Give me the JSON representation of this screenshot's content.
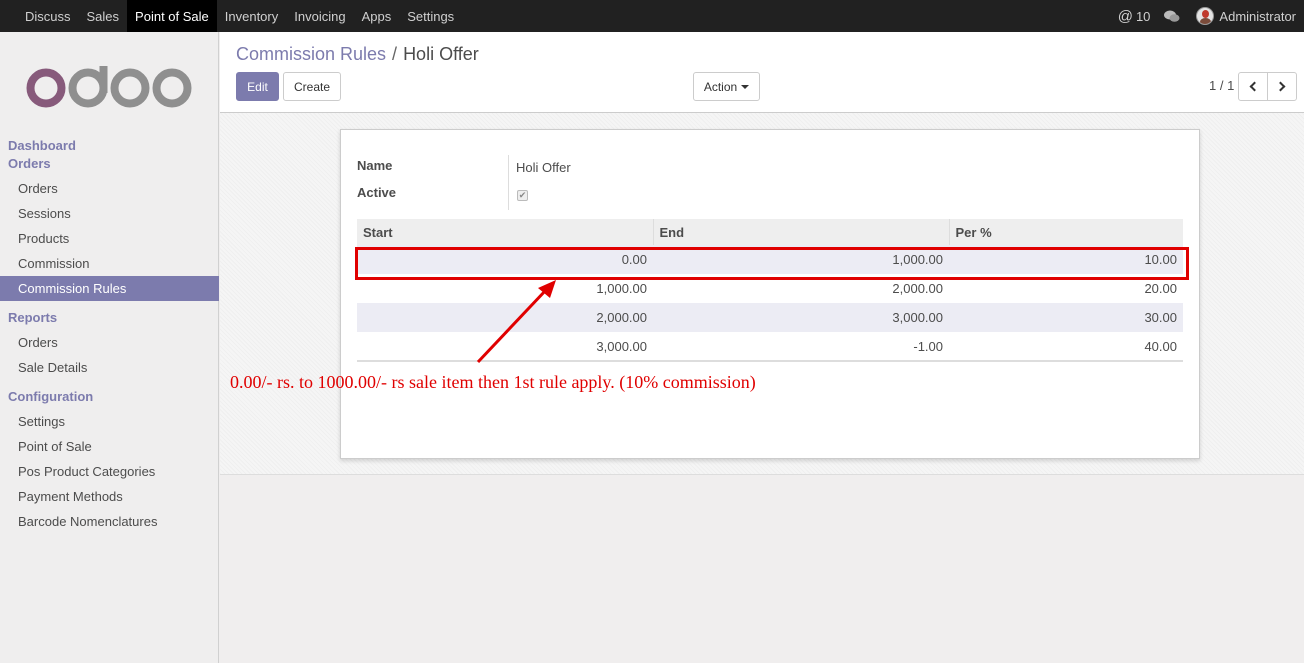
{
  "topbar": {
    "menu": [
      "Discuss",
      "Sales",
      "Point of Sale",
      "Inventory",
      "Invoicing",
      "Apps",
      "Settings"
    ],
    "active_menu": "Point of Sale",
    "mentions_count": "10",
    "mention_icon": "at-icon",
    "chat_icon": "chat-bubbles-icon",
    "user_name": "Administrator"
  },
  "brand": {
    "logo_text": "odoo",
    "logo_colors": [
      "#875a7b",
      "#8f8f8f"
    ]
  },
  "sidebar": {
    "sections": [
      {
        "title": "Dashboard",
        "items": []
      },
      {
        "title": "Orders",
        "items": [
          "Orders",
          "Sessions",
          "Products",
          "Commission",
          "Commission Rules"
        ]
      },
      {
        "title": "Reports",
        "items": [
          "Orders",
          "Sale Details"
        ]
      },
      {
        "title": "Configuration",
        "items": [
          "Settings",
          "Point of Sale",
          "Pos Product Categories",
          "Payment Methods",
          "Barcode Nomenclatures"
        ]
      }
    ],
    "active_item": "Commission Rules"
  },
  "control": {
    "breadcrumb_parent": "Commission Rules",
    "breadcrumb_sep": "/",
    "breadcrumb_current": "Holi Offer",
    "edit_label": "Edit",
    "create_label": "Create",
    "action_label": "Action",
    "pager": "1 / 1"
  },
  "form": {
    "name_label": "Name",
    "name_value": "Holi Offer",
    "active_label": "Active",
    "active_checked": true
  },
  "rules_table": {
    "columns": [
      "Start",
      "End",
      "Per %"
    ],
    "rows": [
      [
        "0.00",
        "1,000.00",
        "10.00"
      ],
      [
        "1,000.00",
        "2,000.00",
        "20.00"
      ],
      [
        "2,000.00",
        "3,000.00",
        "30.00"
      ],
      [
        "3,000.00",
        "-1.00",
        "40.00"
      ]
    ]
  },
  "annotation": {
    "text": "0.00/- rs. to 1000.00/- rs sale item then 1st rule apply. (10% commission)",
    "color": "#e00000"
  },
  "colors": {
    "accent": "#7c7bad",
    "topbar": "#212121"
  }
}
